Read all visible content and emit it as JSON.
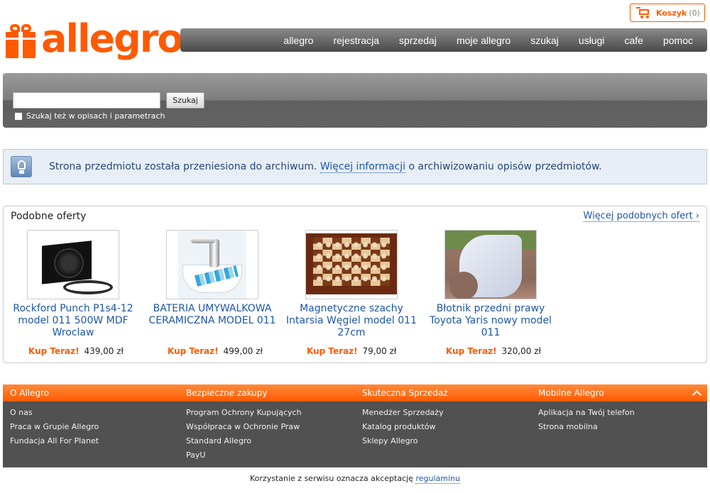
{
  "header": {
    "logo_text": "allegro",
    "cart": {
      "label": "Koszyk",
      "count": "(0)"
    },
    "nav": [
      "allegro",
      "rejestracja",
      "sprzedaj",
      "moje allegro",
      "szukaj",
      "usługi",
      "cafe",
      "pomoc"
    ]
  },
  "search": {
    "value": "",
    "button_label": "Szukaj",
    "checkbox_label": "Szukaj też w opisach i parametrach",
    "checkbox_checked": false
  },
  "info": {
    "text_before": "Strona przedmiotu została przeniesiona do archiwum.",
    "link_text": "Więcej informacji",
    "text_after": "o archiwizowaniu opisów przedmiotów."
  },
  "offers": {
    "title": "Podobne oferty",
    "more_link": "Więcej podobnych ofert ›",
    "buy_label": "Kup Teraz!",
    "items": [
      {
        "title": "Rockford Punch P1s4-12 model 011 500W MDF Wroclaw",
        "price": "439,00 zł"
      },
      {
        "title": "BATERIA UMYWALKOWA CERAMICZNA MODEL 011",
        "price": "499,00 zł"
      },
      {
        "title": "Magnetyczne szachy Intarsia Węgiel model 011 27cm",
        "price": "79,00 zł"
      },
      {
        "title": "Błotnik przedni prawy Toyota Yaris nowy model 011",
        "price": "320,00 zł"
      }
    ]
  },
  "footer": {
    "columns": [
      {
        "heading": "O Allegro",
        "links": [
          "O nas",
          "Praca w Grupie Allegro",
          "Fundacja All For Planet"
        ]
      },
      {
        "heading": "Bezpieczne zakupy",
        "links": [
          "Program Ochrony Kupujących",
          "Współpraca w Ochronie Praw",
          "Standard Allegro",
          "PayU"
        ]
      },
      {
        "heading": "Skuteczna Sprzedaż",
        "links": [
          "Menedżer Sprzedaży",
          "Katalog produktów",
          "Sklepy Allegro"
        ]
      },
      {
        "heading": "Mobilne Allegro",
        "links": [
          "Aplikacja na Twój telefon",
          "Strona mobilna"
        ]
      }
    ],
    "legal_text": "Korzystanie z serwisu oznacza akceptację",
    "legal_link": "regulaminu"
  },
  "colors": {
    "brand": "#ff5a00",
    "link": "#1d56a8",
    "nav_bg": "#5a5a5a"
  }
}
